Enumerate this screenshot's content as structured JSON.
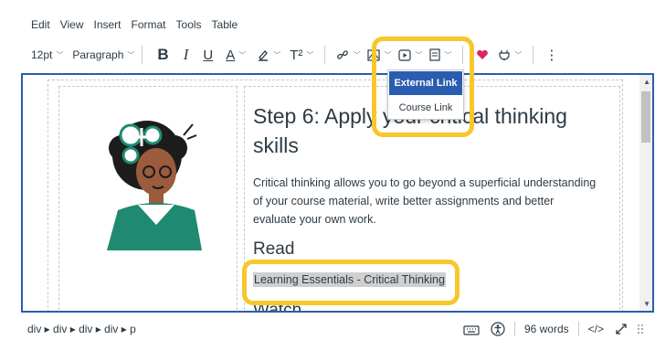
{
  "menu": [
    "Edit",
    "View",
    "Insert",
    "Format",
    "Tools",
    "Table"
  ],
  "toolbar": {
    "font_size": "12pt",
    "block_format": "Paragraph",
    "bold": "B",
    "italic": "I",
    "underline": "U",
    "text_color": "A",
    "superscript": "T²",
    "more": "⋮"
  },
  "dropdown": {
    "external_link": "External Link",
    "course_link": "Course Link"
  },
  "content": {
    "heading": "Step 6: Apply your critical thinking skills",
    "paragraph": "Critical thinking allows you to go beyond a superficial understanding of your course material, write better assignments and better evaluate your own work.",
    "read_heading": "Read",
    "link_text": "Learning Essentials - Critical Thinking",
    "watch_heading": "Watch"
  },
  "status": {
    "breadcrumb": "div ▸ div ▸ div ▸ div ▸ p",
    "word_count": "96 words",
    "html_toggle": "</>"
  },
  "colors": {
    "accent": "#2a5db0",
    "highlight": "#f7c72b",
    "text": "#2d3b45"
  }
}
